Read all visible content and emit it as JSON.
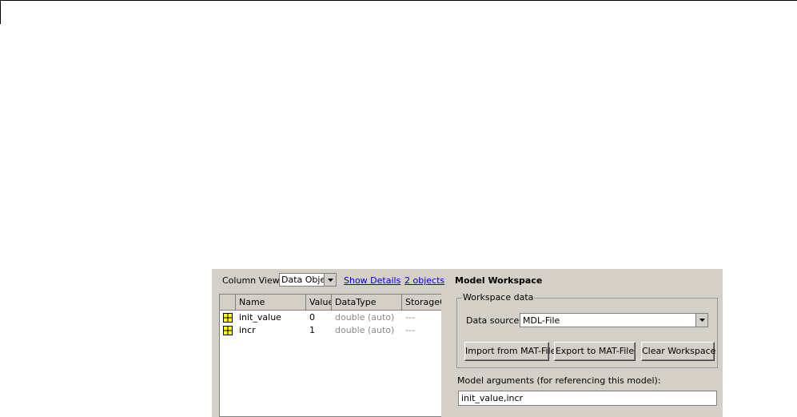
{
  "toolbar": {
    "column_view_label": "Column View:",
    "column_view_value": "Data Objects",
    "show_details_link": "Show Details",
    "objects_count_link": "2 objects"
  },
  "table": {
    "headers": [
      "Name",
      "Value",
      "DataType",
      "StorageClass"
    ],
    "rows": [
      {
        "name": "init_value",
        "value": "0",
        "datatype": "double (auto)",
        "storage": "---"
      },
      {
        "name": "incr",
        "value": "1",
        "datatype": "double (auto)",
        "storage": "---"
      }
    ]
  },
  "model_workspace": {
    "title": "Model Workspace",
    "group_label": "Workspace data",
    "data_source_label": "Data source:",
    "data_source_value": "MDL-File",
    "import_button": "Import from MAT-File",
    "export_button": "Export to MAT-File",
    "clear_button": "Clear Workspace",
    "model_args_label": "Model arguments (for referencing this model):",
    "model_args_value": "init_value,incr"
  },
  "colors": {
    "panel_bg": "#d4d0c8",
    "link": "#0000cc",
    "variable_icon": "#ffff00"
  }
}
